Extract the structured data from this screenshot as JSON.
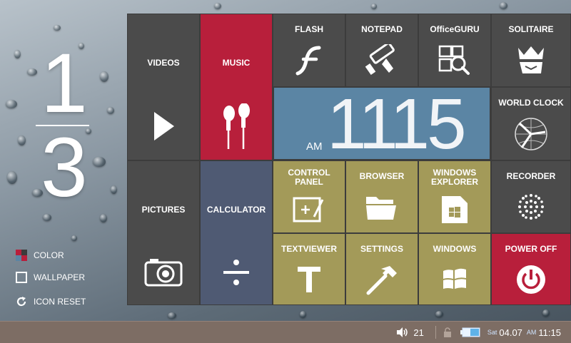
{
  "page": {
    "current": "1",
    "total": "3"
  },
  "options": [
    {
      "name": "color",
      "label": "COLOR"
    },
    {
      "name": "wallpaper",
      "label": "WALLPAPER"
    },
    {
      "name": "icon-reset",
      "label": "ICON RESET"
    }
  ],
  "tiles": {
    "videos": {
      "label": "VIDEOS",
      "icon": "play-icon"
    },
    "music": {
      "label": "MUSIC",
      "icon": "earphones-icon"
    },
    "flash": {
      "label": "FLASH",
      "icon": "flash-icon"
    },
    "notepad": {
      "label": "NOTEPAD",
      "icon": "paint-roller-icon"
    },
    "officeguru": {
      "label": "OfficeGURU",
      "icon": "office-search-icon"
    },
    "solitaire": {
      "label": "SOLITAIRE",
      "icon": "card-king-icon"
    },
    "world_clock": {
      "label": "WORLD CLOCK",
      "icon": "globe-clock-icon"
    },
    "pictures": {
      "label": "PICTURES",
      "icon": "camera-icon"
    },
    "calculator": {
      "label": "CALCULATOR",
      "icon": "divide-icon"
    },
    "control_panel": {
      "label_line1": "CONTROL",
      "label_line2": "PANEL",
      "icon": "control-panel-icon"
    },
    "browser": {
      "label": "BROWSER",
      "icon": "folder-icon"
    },
    "windows_explorer": {
      "label_line1": "WINDOWS",
      "label_line2": "EXPLORER",
      "icon": "windows-file-icon"
    },
    "recorder": {
      "label": "RECORDER",
      "icon": "speaker-dots-icon"
    },
    "textviewer": {
      "label": "TEXTVIEWER",
      "icon": "text-t-icon"
    },
    "settings": {
      "label": "SETTINGS",
      "icon": "hammer-icon"
    },
    "windows": {
      "label": "WINDOWS",
      "icon": "windows-logo-icon"
    },
    "power_off": {
      "label": "POWER OFF",
      "icon": "power-icon"
    }
  },
  "clock": {
    "ampm": "AM",
    "time": "1115"
  },
  "taskbar": {
    "volume": "21",
    "day": "Sat",
    "date": "04.07",
    "ampm": "AM",
    "time": "11:15"
  },
  "colors": {
    "dark": "#4b4b4b",
    "red": "#b81f3b",
    "slate": "#4f5a73",
    "olive": "#a39a59",
    "blue": "#5b85a4",
    "taskbar": "#7d6d64"
  }
}
